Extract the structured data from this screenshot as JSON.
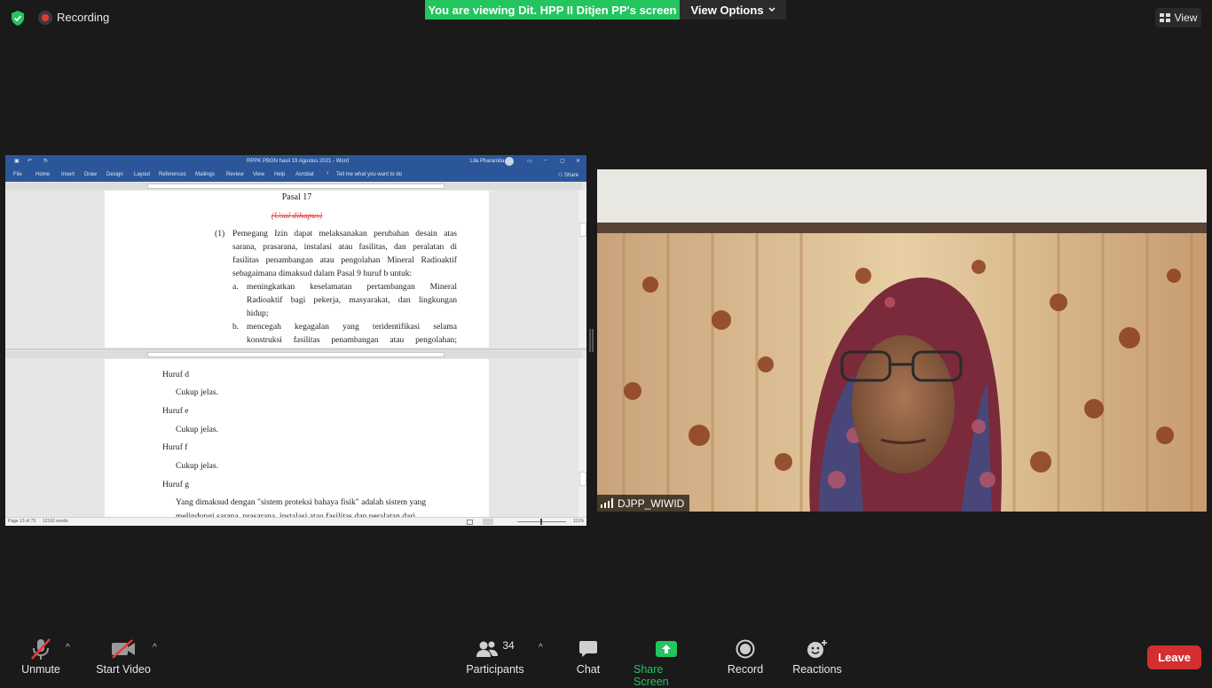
{
  "topbar": {
    "recording_label": "Recording",
    "banner_text": "You are viewing Dit. HPP II Ditjen PP's screen",
    "view_options_label": "View Options",
    "view_label": "View"
  },
  "shared_window": {
    "title": "RPPK PBGN hasil 19 Agustus 2021  -  Word",
    "user": "Lila Pharamita",
    "menu": [
      "File",
      "Home",
      "Insert",
      "Draw",
      "Design",
      "Layout",
      "References",
      "Mailings",
      "Review",
      "View",
      "Help",
      "Acrobat"
    ],
    "tell_me": "Tell me what you want to do",
    "share": "Share",
    "pane1": {
      "heading": "Pasal 17",
      "struck": "(Usul dihapus)",
      "item_num": "(1)",
      "lines": [
        "Pemegang Izin dapat melaksanakan perubahan desain atas",
        "sarana, prasarana, instalasi atau fasilitas, dan peralatan di",
        "fasilitas penambangan atau pengolahan Mineral Radioaktif",
        "sebagaimana dimaksud dalam Pasal 9 huruf b untuk:"
      ],
      "sub_a_label": "a.",
      "sub_a": [
        "meningkatkan keselamatan pertambangan Mineral",
        "Radioaktif bagi pekerja, masyarakat, dan lingkungan",
        "hidup;"
      ],
      "sub_b_label": "b.",
      "sub_b": [
        "mencegah kegagalan yang teridentifikasi selama",
        "konstruksi fasilitas penambangan atau pengolahan;"
      ]
    },
    "pane2": {
      "h_d": "Huruf d",
      "t_d": "Cukup jelas.",
      "h_e": "Huruf e",
      "t_e": "Cukup jelas.",
      "h_f": "Huruf f",
      "t_f": "Cukup jelas.",
      "h_g": "Huruf g",
      "t_g1": "Yang dimaksud dengan \"sistem proteksi bahaya fisik\" adalah sistem yang",
      "t_g2": "melindungi sarana, prasarana, instalasi atau fasilitas dan peralatan dari"
    },
    "status": {
      "page": "Page 13 of 73",
      "words": "12162 words",
      "zoom": "111%"
    }
  },
  "participant_tile": {
    "name": "DJPP_WIWID"
  },
  "toolbar": {
    "unmute": "Unmute",
    "start_video": "Start Video",
    "participants": "Participants",
    "participants_count": "34",
    "chat": "Chat",
    "share_screen": "Share Screen",
    "record": "Record",
    "reactions": "Reactions",
    "leave": "Leave"
  },
  "colors": {
    "background": "#1a1a1a",
    "banner_green": "#22c55e",
    "word_blue": "#2b579a",
    "leave_red": "#d32f2f",
    "share_green": "#22c55e"
  }
}
